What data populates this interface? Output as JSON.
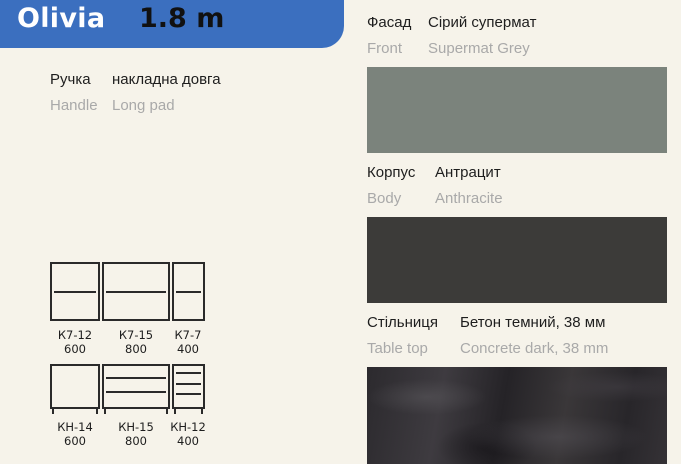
{
  "header": {
    "model": "Olivia",
    "size": "1.8 m"
  },
  "handle": {
    "label_ua": "Ручка",
    "value_ua": "накладна довга",
    "label_en": "Handle",
    "value_en": "Long pad"
  },
  "front": {
    "label_ua": "Фасад",
    "value_ua": "Сірий супермат",
    "label_en": "Front",
    "value_en": "Supermat Grey",
    "color": "#7b837c"
  },
  "body": {
    "label_ua": "Корпус",
    "value_ua": "Антрацит",
    "label_en": "Body",
    "value_en": "Anthracite",
    "color": "#3c3b39"
  },
  "tabletop": {
    "label_ua": "Стільниця",
    "value_ua": "Бетон темний, 38 мм",
    "label_en": "Table top",
    "value_en": "Concrete dark, 38 mm",
    "color": "#2f2d31"
  },
  "upper_cabinets": [
    {
      "code": "К7-12",
      "width": "600"
    },
    {
      "code": "К7-15",
      "width": "800"
    },
    {
      "code": "К7-7",
      "width": "400"
    }
  ],
  "lower_cabinets": [
    {
      "code": "КН-14",
      "width": "600"
    },
    {
      "code": "КН-15",
      "width": "800"
    },
    {
      "code": "КН-12",
      "width": "400"
    }
  ]
}
